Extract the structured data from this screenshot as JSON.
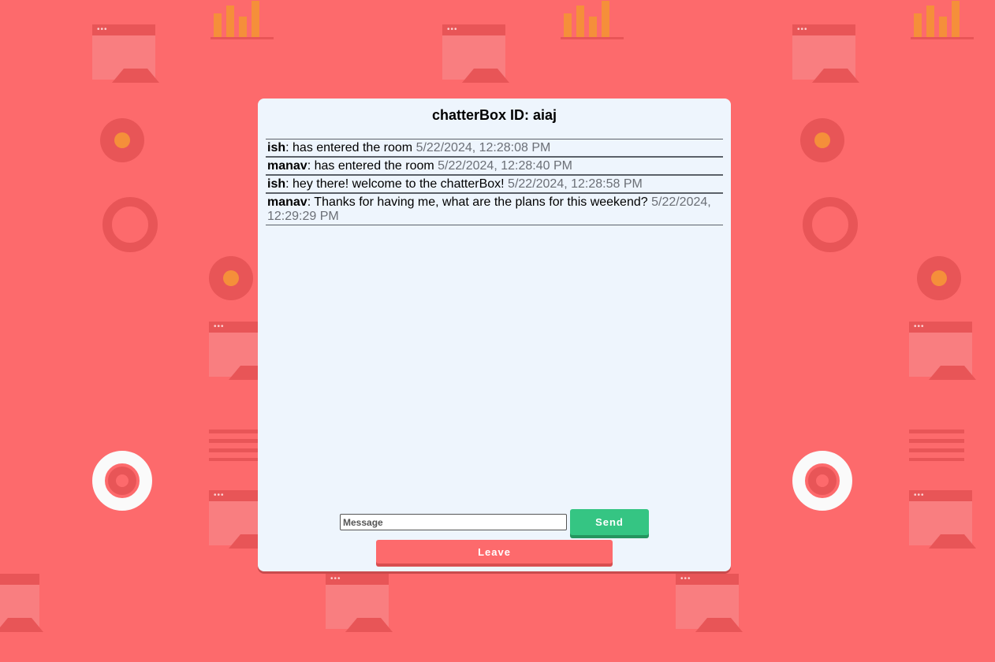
{
  "colors": {
    "background": "#fd6a6c",
    "card": "#eef5fd",
    "send_button": "#35c583",
    "leave_button": "#fd6a6c",
    "timestamp": "#6b6f76"
  },
  "chat": {
    "title": "chatterBox ID: aiaj",
    "messages": [
      {
        "sender": "ish",
        "text": ": has entered the room ",
        "time": "5/22/2024, 12:28:08 PM"
      },
      {
        "sender": "manav",
        "text": ": has entered the room ",
        "time": "5/22/2024, 12:28:40 PM"
      },
      {
        "sender": "ish",
        "text": ": hey there! welcome to the chatterBox! ",
        "time": "5/22/2024, 12:28:58 PM"
      },
      {
        "sender": "manav",
        "text": ": Thanks for having me, what are the plans for this weekend? ",
        "time": "5/22/2024, 12:29:29 PM"
      }
    ]
  },
  "composer": {
    "input_placeholder": "Message",
    "input_value": "",
    "send_label": "Send",
    "leave_label": "Leave"
  }
}
